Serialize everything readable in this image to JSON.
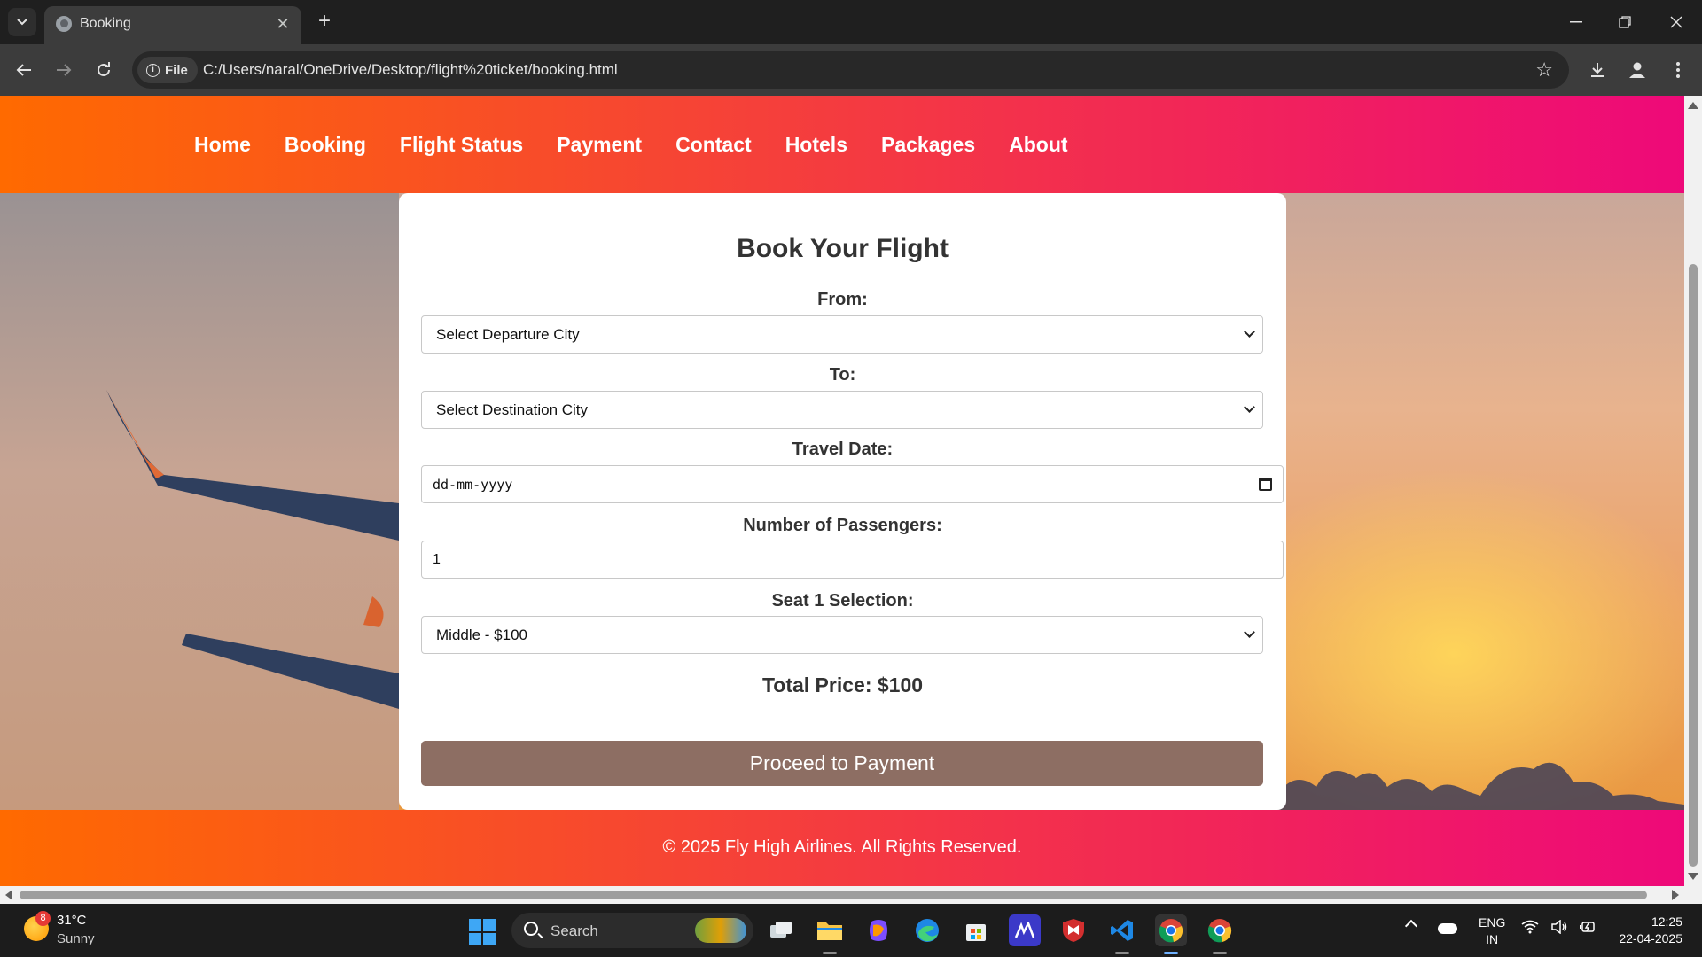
{
  "browser": {
    "tab_title": "Booking",
    "file_chip": "File",
    "url": "C:/Users/naral/OneDrive/Desktop/flight%20ticket/booking.html"
  },
  "site": {
    "nav": [
      "Home",
      "Booking",
      "Flight Status",
      "Payment",
      "Contact",
      "Hotels",
      "Packages",
      "About"
    ],
    "footer": "© 2025 Fly High Airlines. All Rights Reserved."
  },
  "form": {
    "title": "Book Your Flight",
    "from_label": "From:",
    "from_value": "Select Departure City",
    "to_label": "To:",
    "to_value": "Select Destination City",
    "date_label": "Travel Date:",
    "date_placeholder": "dd-mm-yyyy",
    "passengers_label": "Number of Passengers:",
    "passengers_value": "1",
    "seat_label": "Seat 1 Selection:",
    "seat_value": "Middle - $100",
    "total_price": "Total Price: $100",
    "submit_label": "Proceed to Payment"
  },
  "taskbar": {
    "weather_badge": "8",
    "weather_temp": "31°C",
    "weather_desc": "Sunny",
    "search_label": "Search",
    "lang_line1": "ENG",
    "lang_line2": "IN",
    "time": "12:25",
    "date": "22-04-2025"
  },
  "colors": {
    "header_gradient_start": "#ff6a00",
    "header_gradient_end": "#ee0979",
    "button": "#8d6e63",
    "card": "#ffffff"
  }
}
